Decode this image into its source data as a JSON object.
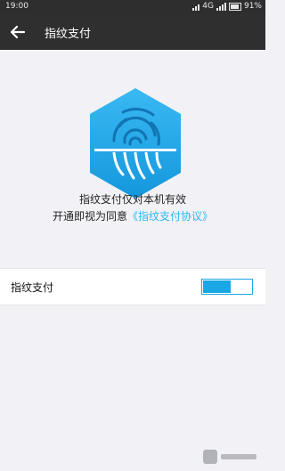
{
  "status_bar": {
    "time": "19:00",
    "network": "4G",
    "battery": "91%"
  },
  "app_bar": {
    "title": "指纹支付"
  },
  "description": {
    "line1": "指纹支付仅对本机有效",
    "line2_prefix": "开通即视为同意",
    "agreement_link": "《指纹支付协议》"
  },
  "setting": {
    "label": "指纹支付",
    "enabled": true
  },
  "colors": {
    "accent": "#19a7e6",
    "link": "#2bb7ef",
    "appbar": "#2f2f2f"
  }
}
